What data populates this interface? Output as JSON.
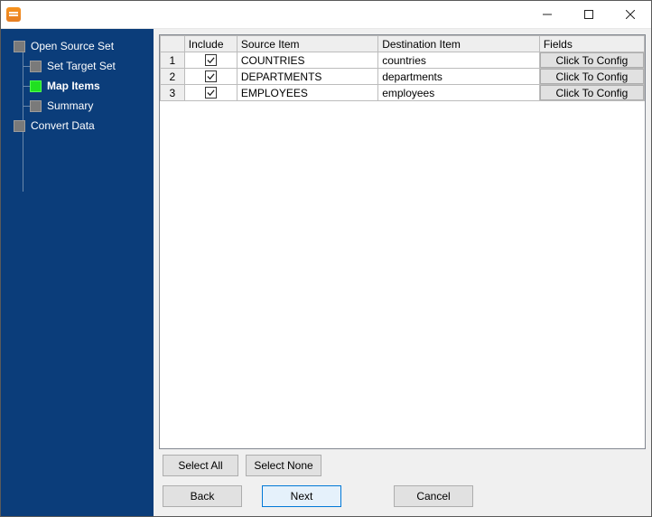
{
  "window": {
    "title": ""
  },
  "sidebar": {
    "items": [
      {
        "label": "Open Source Set",
        "active": false,
        "child": false
      },
      {
        "label": "Set Target Set",
        "active": false,
        "child": true
      },
      {
        "label": "Map Items",
        "active": true,
        "child": true
      },
      {
        "label": "Summary",
        "active": false,
        "child": true
      },
      {
        "label": "Convert Data",
        "active": false,
        "child": false
      }
    ]
  },
  "grid": {
    "columns": {
      "rownum": "",
      "include": "Include",
      "source": "Source Item",
      "destination": "Destination Item",
      "fields": "Fields"
    },
    "config_button_label": "Click To Config",
    "rows": [
      {
        "n": "1",
        "include": true,
        "source": "COUNTRIES",
        "destination": "countries"
      },
      {
        "n": "2",
        "include": true,
        "source": "DEPARTMENTS",
        "destination": "departments"
      },
      {
        "n": "3",
        "include": true,
        "source": "EMPLOYEES",
        "destination": "employees"
      }
    ]
  },
  "buttons": {
    "select_all": "Select All",
    "select_none": "Select None",
    "back": "Back",
    "next": "Next",
    "cancel": "Cancel"
  }
}
